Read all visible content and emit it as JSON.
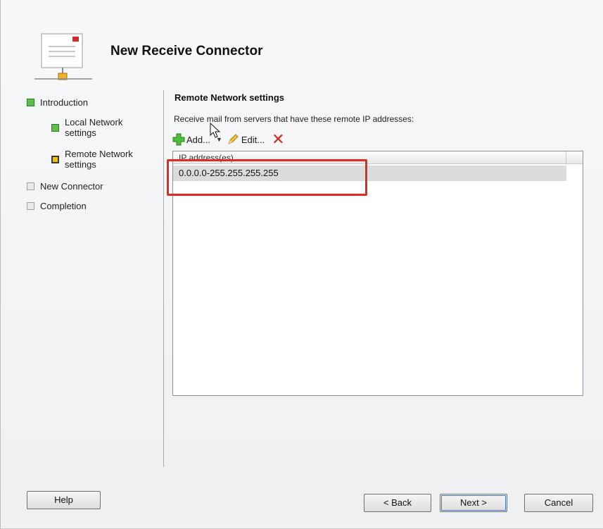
{
  "window": {
    "title": "New Receive Connector"
  },
  "nav": {
    "items": [
      {
        "label": "Introduction",
        "state": "complete"
      },
      {
        "label": "Local Network settings",
        "state": "complete"
      },
      {
        "label": "Remote Network settings",
        "state": "current"
      },
      {
        "label": "New Connector",
        "state": "pending"
      },
      {
        "label": "Completion",
        "state": "pending"
      }
    ]
  },
  "page": {
    "section_title": "Remote Network settings",
    "instruction": "Receive mail from servers that have these remote IP addresses:"
  },
  "toolbar": {
    "add_label": "Add...",
    "edit_label": "Edit..."
  },
  "list": {
    "column_header": "IP address(es)",
    "rows": [
      "0.0.0.0-255.255.255.255"
    ]
  },
  "buttons": {
    "help": "Help",
    "back": "< Back",
    "next": "Next >",
    "cancel": "Cancel"
  },
  "colors": {
    "highlight": "#e02b20",
    "complete": "#5cc04a",
    "current": "#f2c200"
  },
  "icons": [
    "connector-wizard-icon",
    "add-icon",
    "dropdown-arrow-icon",
    "edit-icon",
    "delete-icon",
    "mouse-cursor-icon"
  ]
}
